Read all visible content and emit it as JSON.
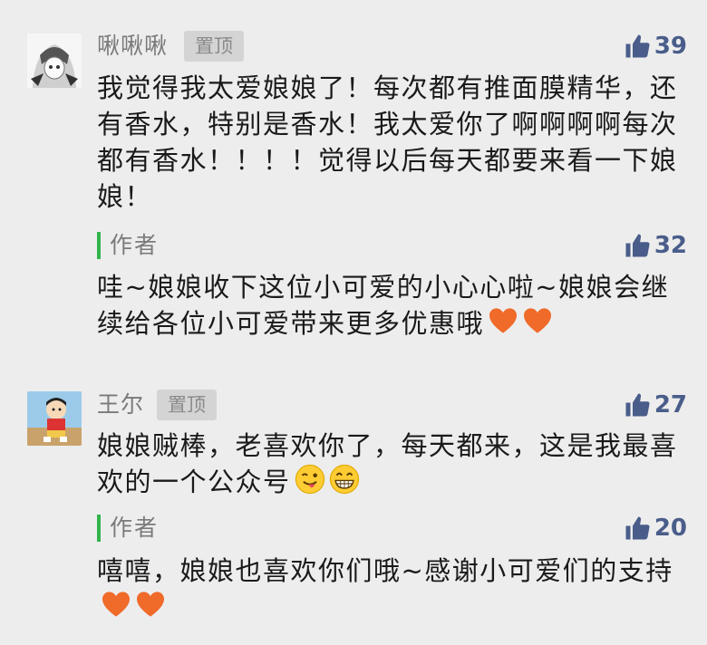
{
  "comments": [
    {
      "nickname": "啾啾啾",
      "pin_label": "置顶",
      "likes": "39",
      "text": "我觉得我太爱娘娘了！每次都有推面膜精华，还有香水，特别是香水！我太爱你了啊啊啊啊每次都有香水！！！！觉得以后每天都要来看一下娘娘！",
      "reply": {
        "author_label": "作者",
        "likes": "32",
        "text": "哇~娘娘收下这位小可爱的小心心啦~娘娘会继续给各位小可爱带来更多优惠哦"
      }
    },
    {
      "nickname": "王尔",
      "pin_label": "置顶",
      "likes": "27",
      "text": "娘娘贼棒，老喜欢你了，每天都来，这是我最喜欢的一个公众号",
      "reply": {
        "author_label": "作者",
        "likes": "20",
        "text": "嘻嘻，娘娘也喜欢你们哦~感谢小可爱们的支持"
      }
    }
  ],
  "colors": {
    "background": "#ededed",
    "like_count": "#4a5d8a",
    "author_bar": "#31b44b",
    "heart": "#f06a2a"
  },
  "icons": [
    "thumbs-up-icon",
    "heart-icon",
    "wink-tongue-emoji",
    "grin-emoji"
  ]
}
